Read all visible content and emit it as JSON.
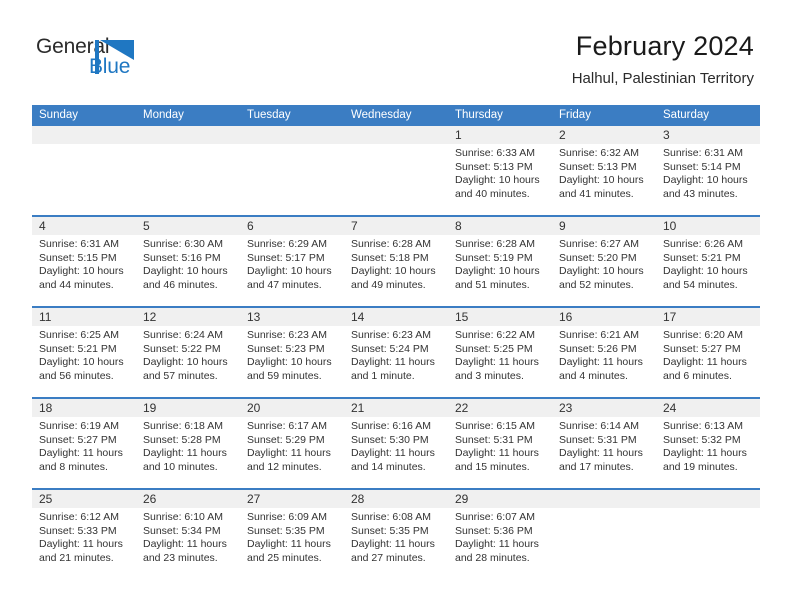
{
  "brand": {
    "name_part1": "General",
    "name_part2": "Blue",
    "logo_icon": "triangle-flag-icon",
    "accent_color": "#1f77c2"
  },
  "header": {
    "title": "February 2024",
    "subtitle": "Halhul, Palestinian Territory"
  },
  "theme": {
    "header_blue": "#3b7dc3",
    "daynum_band": "#f0f0f0",
    "text": "#333333"
  },
  "weekdays": [
    "Sunday",
    "Monday",
    "Tuesday",
    "Wednesday",
    "Thursday",
    "Friday",
    "Saturday"
  ],
  "weeks": [
    {
      "days": [
        {
          "num": "",
          "sunrise": "",
          "sunset": "",
          "daylight": ""
        },
        {
          "num": "",
          "sunrise": "",
          "sunset": "",
          "daylight": ""
        },
        {
          "num": "",
          "sunrise": "",
          "sunset": "",
          "daylight": ""
        },
        {
          "num": "",
          "sunrise": "",
          "sunset": "",
          "daylight": ""
        },
        {
          "num": "1",
          "sunrise": "Sunrise: 6:33 AM",
          "sunset": "Sunset: 5:13 PM",
          "daylight": "Daylight: 10 hours and 40 minutes."
        },
        {
          "num": "2",
          "sunrise": "Sunrise: 6:32 AM",
          "sunset": "Sunset: 5:13 PM",
          "daylight": "Daylight: 10 hours and 41 minutes."
        },
        {
          "num": "3",
          "sunrise": "Sunrise: 6:31 AM",
          "sunset": "Sunset: 5:14 PM",
          "daylight": "Daylight: 10 hours and 43 minutes."
        }
      ]
    },
    {
      "days": [
        {
          "num": "4",
          "sunrise": "Sunrise: 6:31 AM",
          "sunset": "Sunset: 5:15 PM",
          "daylight": "Daylight: 10 hours and 44 minutes."
        },
        {
          "num": "5",
          "sunrise": "Sunrise: 6:30 AM",
          "sunset": "Sunset: 5:16 PM",
          "daylight": "Daylight: 10 hours and 46 minutes."
        },
        {
          "num": "6",
          "sunrise": "Sunrise: 6:29 AM",
          "sunset": "Sunset: 5:17 PM",
          "daylight": "Daylight: 10 hours and 47 minutes."
        },
        {
          "num": "7",
          "sunrise": "Sunrise: 6:28 AM",
          "sunset": "Sunset: 5:18 PM",
          "daylight": "Daylight: 10 hours and 49 minutes."
        },
        {
          "num": "8",
          "sunrise": "Sunrise: 6:28 AM",
          "sunset": "Sunset: 5:19 PM",
          "daylight": "Daylight: 10 hours and 51 minutes."
        },
        {
          "num": "9",
          "sunrise": "Sunrise: 6:27 AM",
          "sunset": "Sunset: 5:20 PM",
          "daylight": "Daylight: 10 hours and 52 minutes."
        },
        {
          "num": "10",
          "sunrise": "Sunrise: 6:26 AM",
          "sunset": "Sunset: 5:21 PM",
          "daylight": "Daylight: 10 hours and 54 minutes."
        }
      ]
    },
    {
      "days": [
        {
          "num": "11",
          "sunrise": "Sunrise: 6:25 AM",
          "sunset": "Sunset: 5:21 PM",
          "daylight": "Daylight: 10 hours and 56 minutes."
        },
        {
          "num": "12",
          "sunrise": "Sunrise: 6:24 AM",
          "sunset": "Sunset: 5:22 PM",
          "daylight": "Daylight: 10 hours and 57 minutes."
        },
        {
          "num": "13",
          "sunrise": "Sunrise: 6:23 AM",
          "sunset": "Sunset: 5:23 PM",
          "daylight": "Daylight: 10 hours and 59 minutes."
        },
        {
          "num": "14",
          "sunrise": "Sunrise: 6:23 AM",
          "sunset": "Sunset: 5:24 PM",
          "daylight": "Daylight: 11 hours and 1 minute."
        },
        {
          "num": "15",
          "sunrise": "Sunrise: 6:22 AM",
          "sunset": "Sunset: 5:25 PM",
          "daylight": "Daylight: 11 hours and 3 minutes."
        },
        {
          "num": "16",
          "sunrise": "Sunrise: 6:21 AM",
          "sunset": "Sunset: 5:26 PM",
          "daylight": "Daylight: 11 hours and 4 minutes."
        },
        {
          "num": "17",
          "sunrise": "Sunrise: 6:20 AM",
          "sunset": "Sunset: 5:27 PM",
          "daylight": "Daylight: 11 hours and 6 minutes."
        }
      ]
    },
    {
      "days": [
        {
          "num": "18",
          "sunrise": "Sunrise: 6:19 AM",
          "sunset": "Sunset: 5:27 PM",
          "daylight": "Daylight: 11 hours and 8 minutes."
        },
        {
          "num": "19",
          "sunrise": "Sunrise: 6:18 AM",
          "sunset": "Sunset: 5:28 PM",
          "daylight": "Daylight: 11 hours and 10 minutes."
        },
        {
          "num": "20",
          "sunrise": "Sunrise: 6:17 AM",
          "sunset": "Sunset: 5:29 PM",
          "daylight": "Daylight: 11 hours and 12 minutes."
        },
        {
          "num": "21",
          "sunrise": "Sunrise: 6:16 AM",
          "sunset": "Sunset: 5:30 PM",
          "daylight": "Daylight: 11 hours and 14 minutes."
        },
        {
          "num": "22",
          "sunrise": "Sunrise: 6:15 AM",
          "sunset": "Sunset: 5:31 PM",
          "daylight": "Daylight: 11 hours and 15 minutes."
        },
        {
          "num": "23",
          "sunrise": "Sunrise: 6:14 AM",
          "sunset": "Sunset: 5:31 PM",
          "daylight": "Daylight: 11 hours and 17 minutes."
        },
        {
          "num": "24",
          "sunrise": "Sunrise: 6:13 AM",
          "sunset": "Sunset: 5:32 PM",
          "daylight": "Daylight: 11 hours and 19 minutes."
        }
      ]
    },
    {
      "days": [
        {
          "num": "25",
          "sunrise": "Sunrise: 6:12 AM",
          "sunset": "Sunset: 5:33 PM",
          "daylight": "Daylight: 11 hours and 21 minutes."
        },
        {
          "num": "26",
          "sunrise": "Sunrise: 6:10 AM",
          "sunset": "Sunset: 5:34 PM",
          "daylight": "Daylight: 11 hours and 23 minutes."
        },
        {
          "num": "27",
          "sunrise": "Sunrise: 6:09 AM",
          "sunset": "Sunset: 5:35 PM",
          "daylight": "Daylight: 11 hours and 25 minutes."
        },
        {
          "num": "28",
          "sunrise": "Sunrise: 6:08 AM",
          "sunset": "Sunset: 5:35 PM",
          "daylight": "Daylight: 11 hours and 27 minutes."
        },
        {
          "num": "29",
          "sunrise": "Sunrise: 6:07 AM",
          "sunset": "Sunset: 5:36 PM",
          "daylight": "Daylight: 11 hours and 28 minutes."
        },
        {
          "num": "",
          "sunrise": "",
          "sunset": "",
          "daylight": ""
        },
        {
          "num": "",
          "sunrise": "",
          "sunset": "",
          "daylight": ""
        }
      ]
    }
  ]
}
